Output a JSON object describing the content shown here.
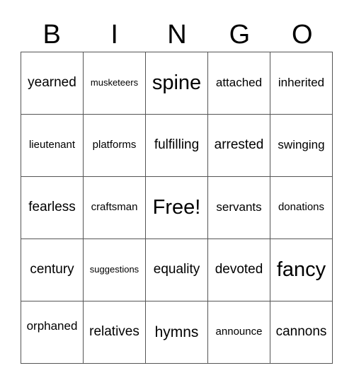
{
  "header": [
    "B",
    "I",
    "N",
    "G",
    "O"
  ],
  "grid": [
    [
      "yearned",
      "musketeers",
      "spine",
      "attached",
      "inherited"
    ],
    [
      "lieutenant",
      "platforms",
      "fulfilling",
      "arrested",
      "swinging"
    ],
    [
      "fearless",
      "craftsman",
      "Free!",
      "servants",
      "donations"
    ],
    [
      "century",
      "suggestions",
      "equality",
      "devoted",
      "fancy"
    ],
    [
      "orphaned",
      "relatives",
      "hymns",
      "announce",
      "cannons"
    ]
  ]
}
